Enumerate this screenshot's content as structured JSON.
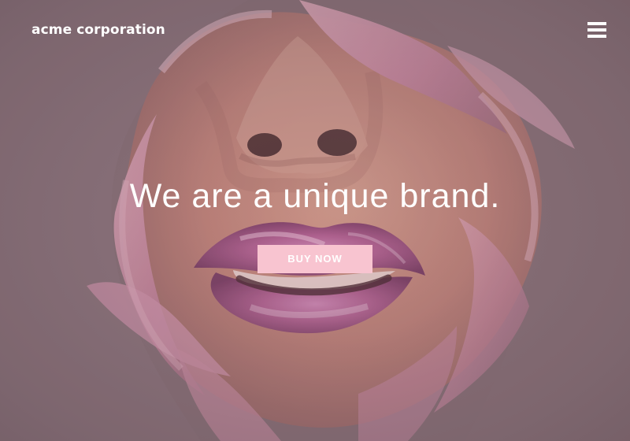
{
  "header": {
    "brand": "acme corporation",
    "menu_icon": "hamburger-menu-icon"
  },
  "hero": {
    "headline": "We are a unique brand.",
    "cta_label": "BUY NOW",
    "image_subject": "close-up of nose and glossy pink lips through torn pink paper"
  },
  "colors": {
    "background": "#8a727a",
    "paper": "#d59ab0",
    "lips": "#b45c90",
    "button": "#f8c4d0",
    "text": "#ffffff"
  }
}
